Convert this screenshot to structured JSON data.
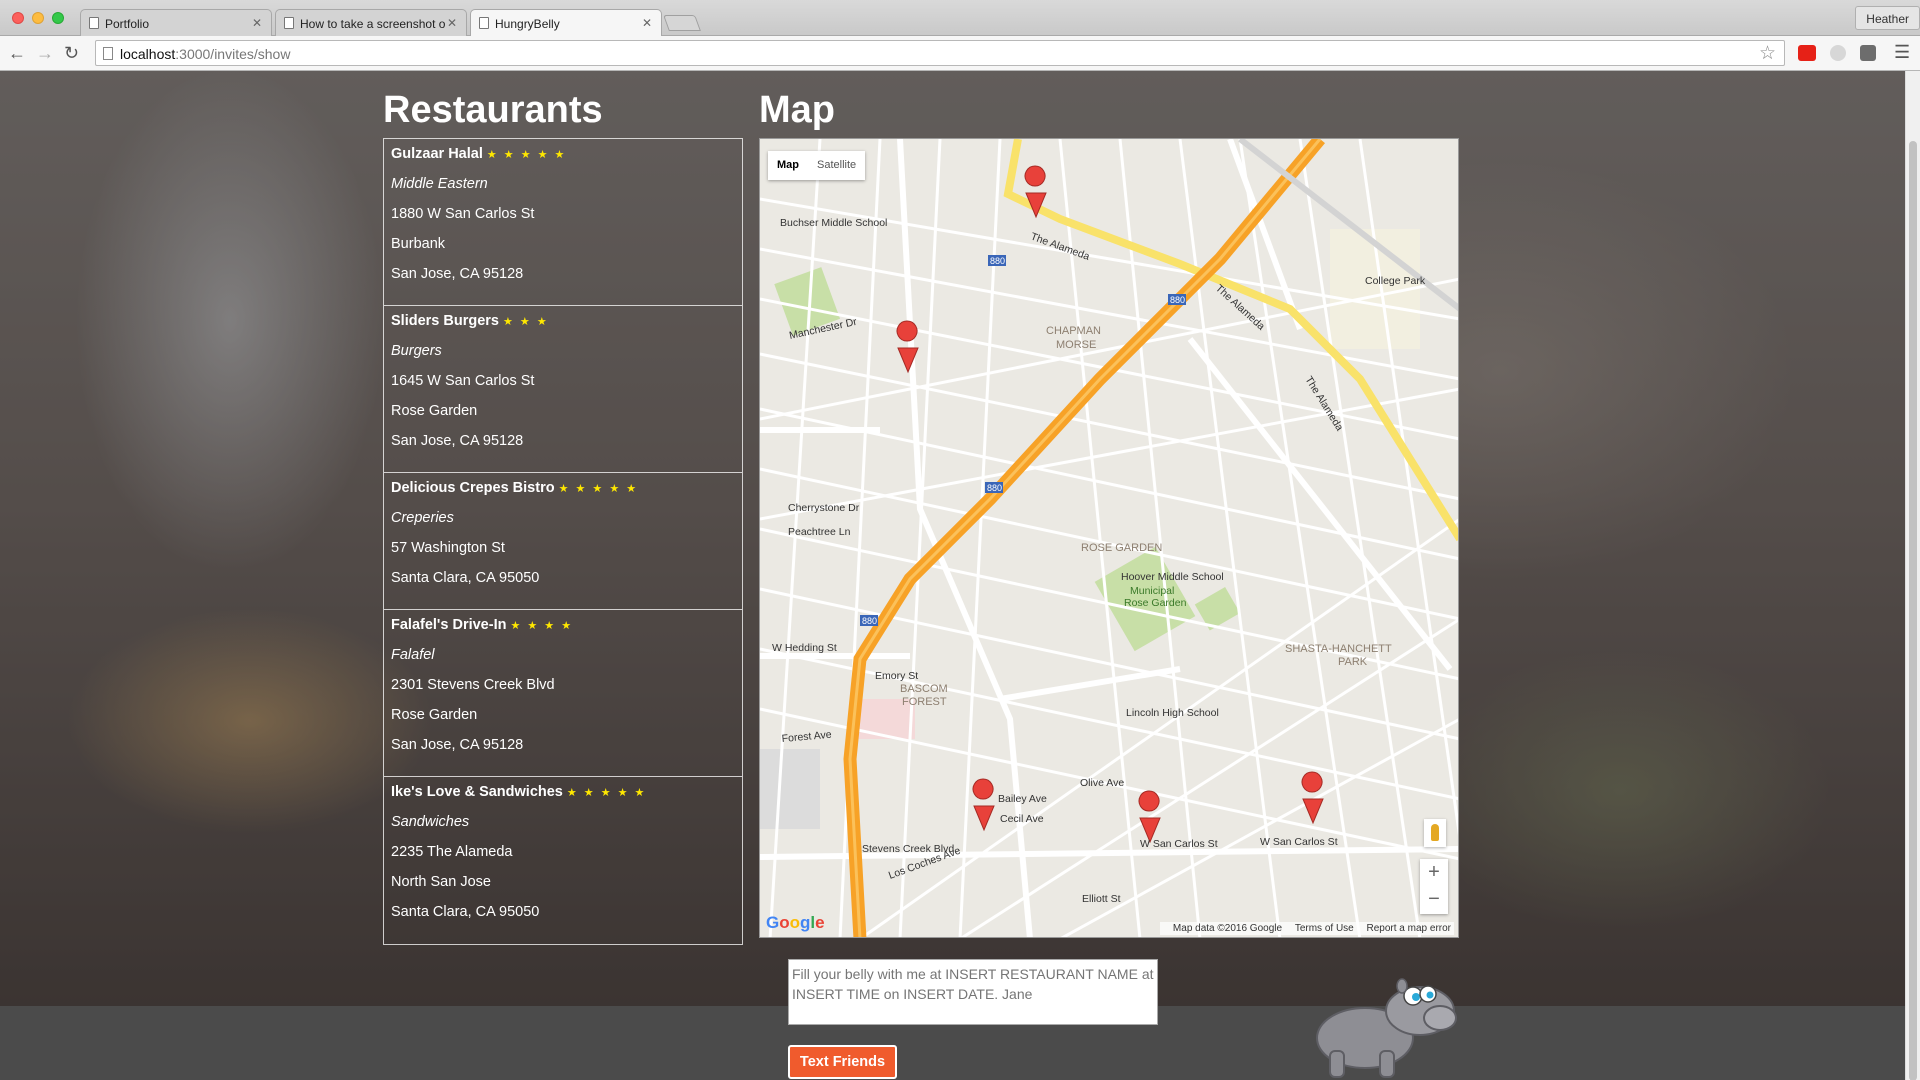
{
  "browser": {
    "tabs": [
      {
        "title": "Portfolio"
      },
      {
        "title": "How to take a screenshot o"
      },
      {
        "title": "HungryBelly"
      }
    ],
    "profile_name": "Heather",
    "url_host": "localhost",
    "url_path": ":3000/invites/show"
  },
  "page": {
    "restaurants_heading": "Restaurants",
    "map_heading": "Map",
    "restaurants": [
      {
        "name": "Gulzaar Halal",
        "stars": "★ ★ ★ ★ ★",
        "cuisine": "Middle Eastern",
        "address": "1880 W San Carlos St",
        "neighborhood": "Burbank",
        "city": "San Jose, CA 95128"
      },
      {
        "name": "Sliders Burgers",
        "stars": "★ ★ ★",
        "cuisine": "Burgers",
        "address": "1645 W San Carlos St",
        "neighborhood": "Rose Garden",
        "city": "San Jose, CA 95128"
      },
      {
        "name": "Delicious Crepes Bistro",
        "stars": "★ ★ ★ ★ ★",
        "cuisine": "Creperies",
        "address": "57 Washington St",
        "city": "Santa Clara, CA 95050"
      },
      {
        "name": "Falafel's Drive-In",
        "stars": "★ ★ ★ ★",
        "cuisine": "Falafel",
        "address": "2301 Stevens Creek Blvd",
        "neighborhood": "Rose Garden",
        "city": "San Jose, CA 95128"
      },
      {
        "name": "Ike's Love & Sandwiches",
        "stars": "★ ★ ★ ★ ★",
        "cuisine": "Sandwiches",
        "address": "2235 The Alameda",
        "neighborhood": "North San Jose",
        "city": "Santa Clara, CA 95050"
      }
    ],
    "map": {
      "type_map": "Map",
      "type_satellite": "Satellite",
      "zoom_in": "+",
      "zoom_out": "−",
      "attribution": "Map data ©2016 Google",
      "terms": "Terms of Use",
      "report": "Report a map error",
      "logo": [
        "G",
        "o",
        "o",
        "g",
        "l",
        "e"
      ],
      "labels": {
        "buchser": "Buchser Middle School",
        "college_park": "College Park",
        "chapman": "CHAPMAN",
        "morse": "MORSE",
        "rose_garden": "ROSE GARDEN",
        "hoover": "Hoover Middle School",
        "municipal": "Municipal",
        "rose_garden_park": "Rose Garden",
        "shasta": "SHASTA-HANCHETT",
        "park": "PARK",
        "bascom": "BASCOM",
        "forest": "FOREST",
        "lincoln": "Lincoln High School",
        "alameda1": "The Alameda",
        "alameda2": "The Alameda",
        "alameda3": "The Alameda",
        "stevens": "Stevens Creek Blvd",
        "san_carlos1": "W San Carlos St",
        "san_carlos2": "W San Carlos St",
        "hedding": "W Hedding St",
        "forest_ave": "Forest Ave",
        "emory": "Emory St",
        "manchester": "Manchester Dr",
        "cherrystone": "Cherrystone Dr",
        "peachtree": "Peachtree Ln",
        "bailey": "Bailey Ave",
        "cecil": "Cecil Ave",
        "olive": "Olive Ave",
        "elliott": "Elliott St",
        "los_coches": "Los Coches Ave",
        "hwy880": "880"
      }
    },
    "message_placeholder": "Fill your belly with me at INSERT RESTAURANT NAME at INSERT TIME on INSERT DATE. Jane",
    "send_button": "Text Friends"
  },
  "colors": {
    "accent": "#f05b2d",
    "stars": "#ffe800",
    "highway": "#f7a227",
    "marker": "#e8413a"
  }
}
